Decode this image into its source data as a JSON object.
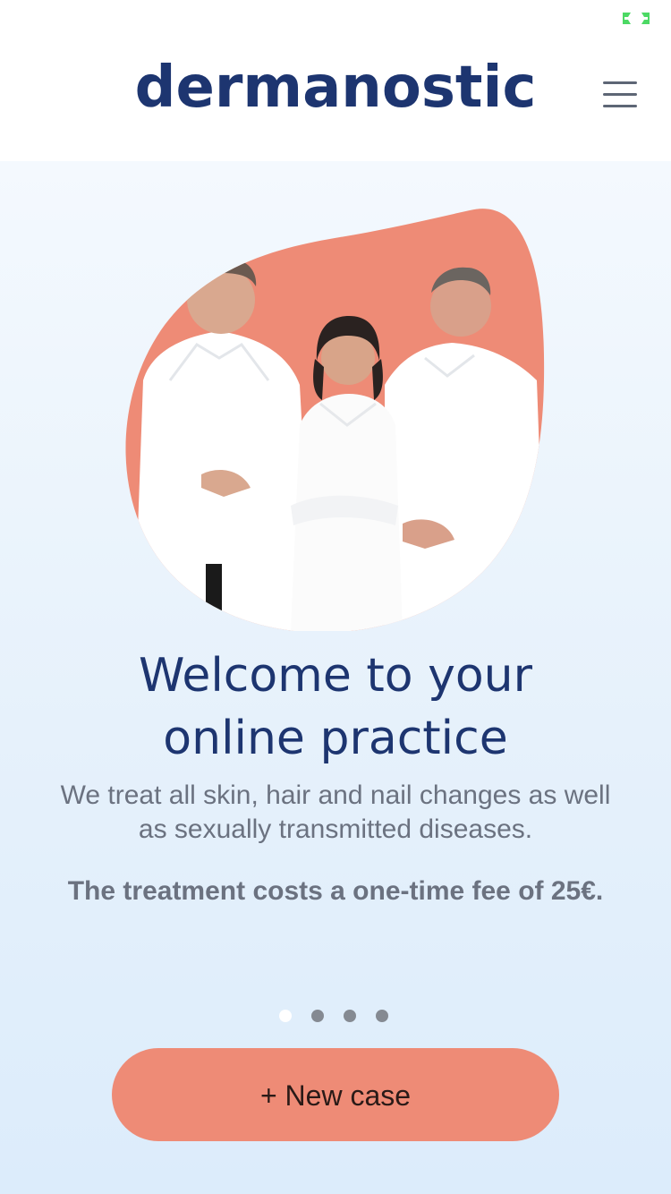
{
  "status_bar": {
    "battery_icon": "battery-charging-icon",
    "icon_color": "#4cd964"
  },
  "header": {
    "logo_text": "dermanostic",
    "menu_icon": "hamburger-menu-icon",
    "brand_color": "#1d3570"
  },
  "hero": {
    "image_subject": "three doctors in white coats",
    "blob_color": "#ee8b76"
  },
  "welcome": {
    "title_line1": "Welcome to your",
    "title_line2": "online practice",
    "description": "We treat all skin, hair and nail changes as well as sexually transmitted diseases.",
    "fee_text": "The treatment costs a one-time fee of 25€."
  },
  "carousel": {
    "total": 4,
    "active_index": 0
  },
  "cta": {
    "new_case_label": "+ New case",
    "button_color": "#ee8b76"
  }
}
